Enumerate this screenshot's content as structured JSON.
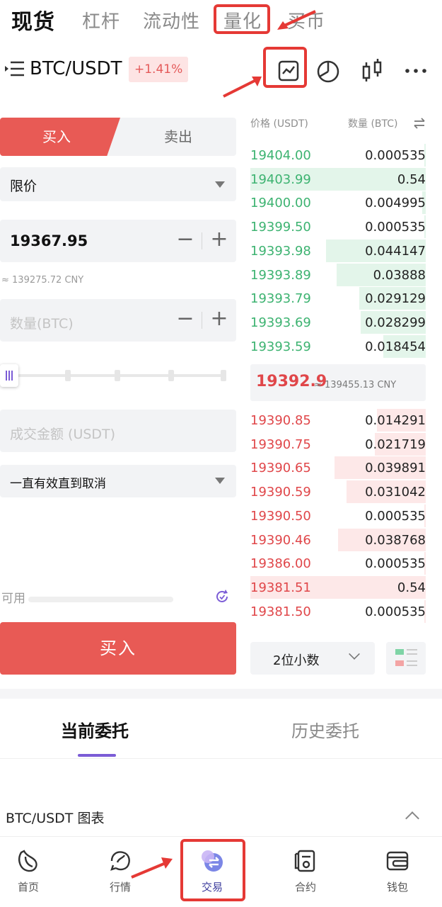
{
  "top_tabs": [
    "现货",
    "杠杆",
    "流动性",
    "量化",
    "买币"
  ],
  "pair": {
    "name": "BTC/USDT",
    "change": "+1.41%"
  },
  "order_form": {
    "buy_tab": "买入",
    "sell_tab": "卖出",
    "order_type": "限价",
    "price_value": "19367.95",
    "price_cny": "≈ 139275.72 CNY",
    "amount_placeholder": "数量(BTC)",
    "total_placeholder": "成交金额 (USDT)",
    "time_in_force": "一直有效直到取消",
    "available_label": "可用",
    "submit_label": "买入",
    "slider_percent": 0
  },
  "order_book": {
    "price_header": "价格 (USDT)",
    "qty_header": "数量 (BTC)",
    "asks": [
      {
        "price": "19404.00",
        "qty": "0.000535",
        "depth": 0.01
      },
      {
        "price": "19403.99",
        "qty": "0.54",
        "depth": 1.0
      },
      {
        "price": "19400.00",
        "qty": "0.004995",
        "depth": 0.02
      },
      {
        "price": "19399.50",
        "qty": "0.000535",
        "depth": 0.01
      },
      {
        "price": "19393.98",
        "qty": "0.044147",
        "depth": 0.57
      },
      {
        "price": "19393.89",
        "qty": "0.03888",
        "depth": 0.51
      },
      {
        "price": "19393.79",
        "qty": "0.029129",
        "depth": 0.38
      },
      {
        "price": "19393.69",
        "qty": "0.028299",
        "depth": 0.37
      },
      {
        "price": "19393.59",
        "qty": "0.018454",
        "depth": 0.24
      }
    ],
    "mid_price": "19392.9",
    "mid_cny": "≈ 139455.13 CNY",
    "bids": [
      {
        "price": "19390.85",
        "qty": "0.014291",
        "depth": 0.28
      },
      {
        "price": "19390.75",
        "qty": "0.021719",
        "depth": 0.29
      },
      {
        "price": "19390.65",
        "qty": "0.039891",
        "depth": 0.52
      },
      {
        "price": "19390.59",
        "qty": "0.031042",
        "depth": 0.45
      },
      {
        "price": "19390.50",
        "qty": "0.000535",
        "depth": 0.01
      },
      {
        "price": "19390.46",
        "qty": "0.038768",
        "depth": 0.5
      },
      {
        "price": "19386.00",
        "qty": "0.000535",
        "depth": 0.01
      },
      {
        "price": "19381.51",
        "qty": "0.54",
        "depth": 1.0
      },
      {
        "price": "19381.50",
        "qty": "0.000535",
        "depth": 0.01
      }
    ],
    "decimals_label": "2位小数"
  },
  "orders": {
    "current_tab": "当前委托",
    "history_tab": "历史委托"
  },
  "chart_section": {
    "label": "BTC/USDT 图表"
  },
  "bottom_nav": [
    {
      "label": "首页",
      "icon": "home-icon"
    },
    {
      "label": "行情",
      "icon": "market-icon"
    },
    {
      "label": "交易",
      "icon": "trade-icon"
    },
    {
      "label": "合约",
      "icon": "contract-icon"
    },
    {
      "label": "钱包",
      "icon": "wallet-icon"
    }
  ],
  "colors": {
    "buy": "#e85a55",
    "ask": "#3db371",
    "bid": "#e0474a",
    "accent": "#7b5cd6",
    "annotation": "#e53935"
  }
}
